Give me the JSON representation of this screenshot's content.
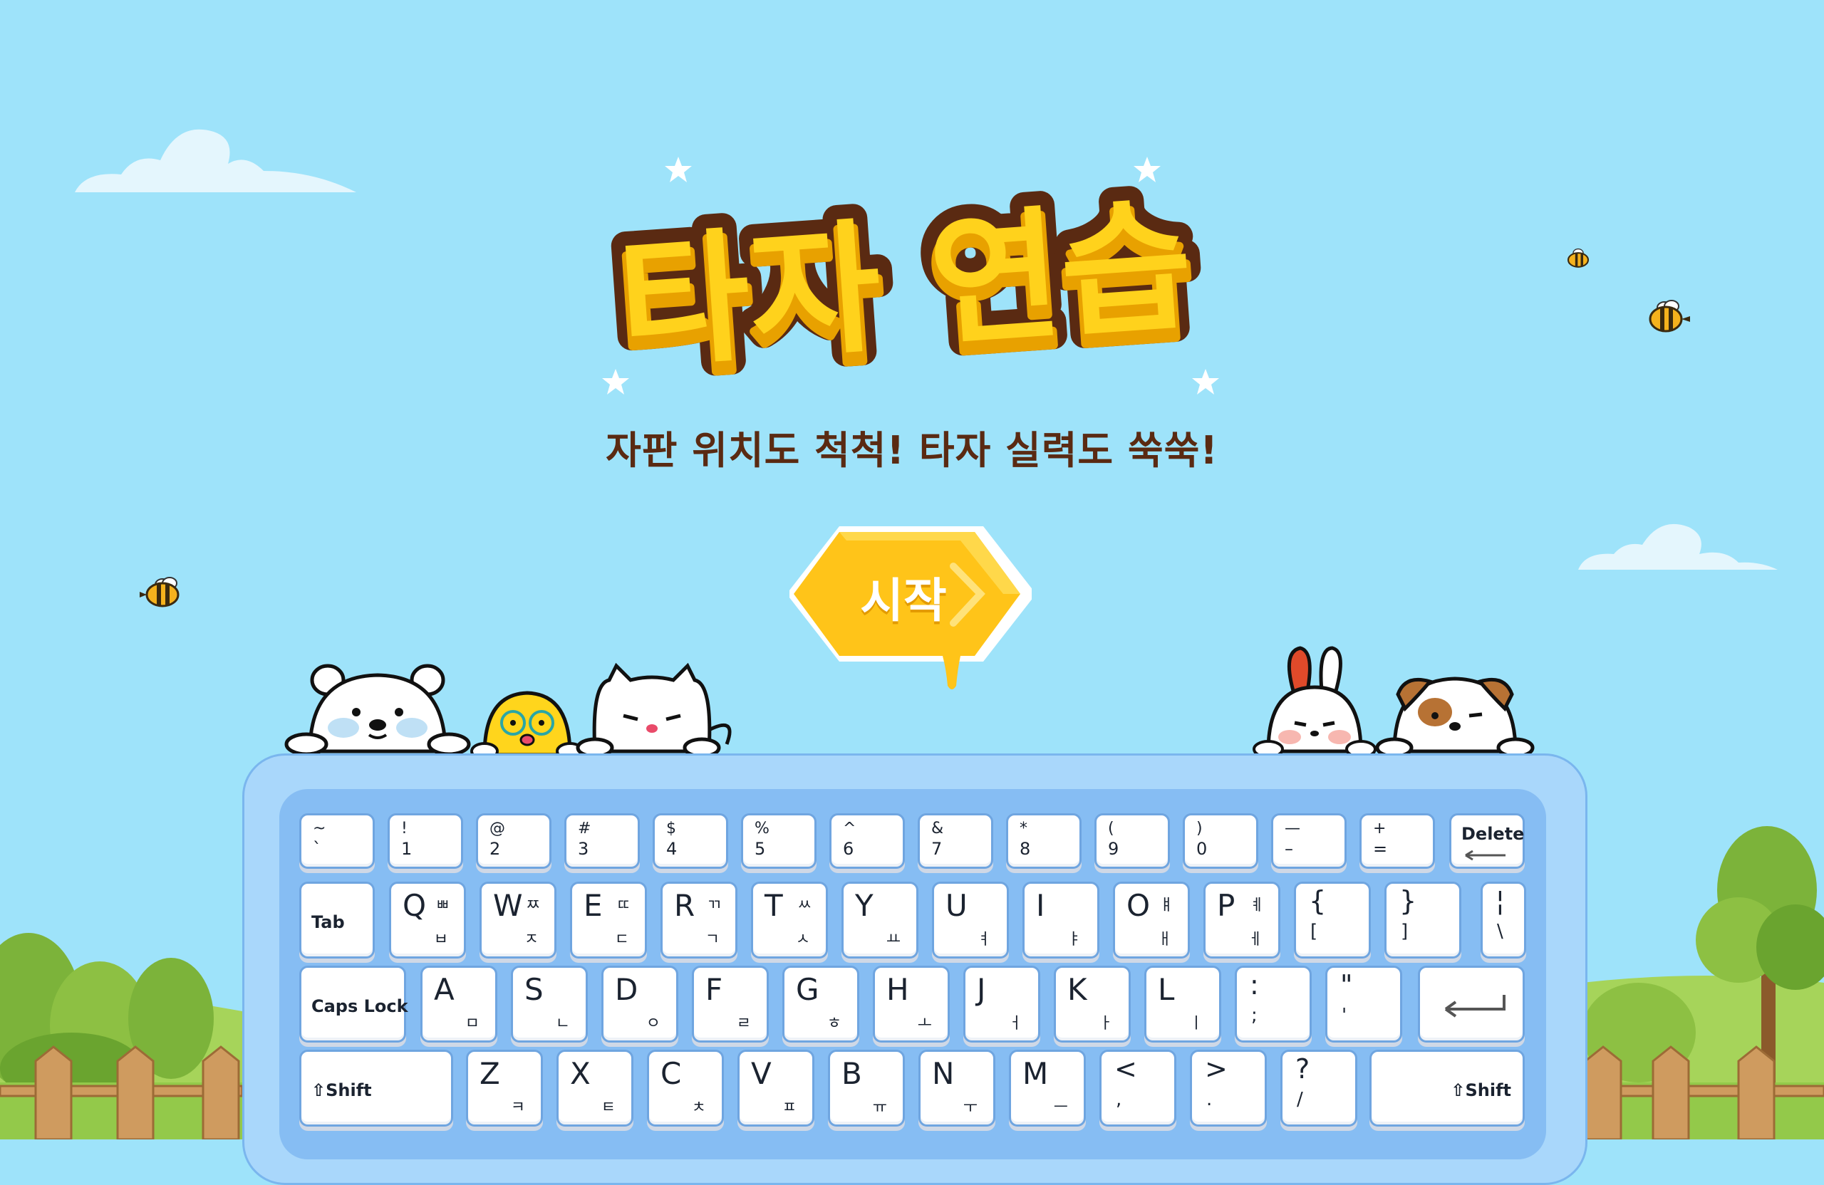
{
  "title": {
    "main": "타자 연습",
    "subtitle": "자판 위치도 척척! 타자 실력도 쑥쑥!"
  },
  "start_button": {
    "label": "시작"
  },
  "colors": {
    "sky": "#9ee3fa",
    "title_fill": "#ffd21c",
    "title_outline": "#5a2a12",
    "button": "#ffc419",
    "grass": "#93c94a",
    "keyboard": "#86bdf3"
  },
  "keyboard": {
    "row1": [
      {
        "top": "~",
        "bot": "`"
      },
      {
        "top": "!",
        "bot": "1"
      },
      {
        "top": "@",
        "bot": "2"
      },
      {
        "top": "#",
        "bot": "3"
      },
      {
        "top": "$",
        "bot": "4"
      },
      {
        "top": "%",
        "bot": "5"
      },
      {
        "top": "^",
        "bot": "6"
      },
      {
        "top": "&",
        "bot": "7"
      },
      {
        "top": "*",
        "bot": "8"
      },
      {
        "top": "(",
        "bot": "9"
      },
      {
        "top": ")",
        "bot": "0"
      },
      {
        "top": "—",
        "bot": "–"
      },
      {
        "top": "+",
        "bot": "="
      }
    ],
    "delete_label": "Delete",
    "tab_label": "Tab",
    "row2": [
      {
        "main": "Q",
        "kr1": "ㅃ",
        "kr2": "ㅂ"
      },
      {
        "main": "W",
        "kr1": "ㅉ",
        "kr2": "ㅈ"
      },
      {
        "main": "E",
        "kr1": "ㄸ",
        "kr2": "ㄷ"
      },
      {
        "main": "R",
        "kr1": "ㄲ",
        "kr2": "ㄱ"
      },
      {
        "main": "T",
        "kr1": "ㅆ",
        "kr2": "ㅅ"
      },
      {
        "main": "Y",
        "kr1": "",
        "kr2": "ㅛ"
      },
      {
        "main": "U",
        "kr1": "",
        "kr2": "ㅕ"
      },
      {
        "main": "I",
        "kr1": "",
        "kr2": "ㅑ"
      },
      {
        "main": "O",
        "kr1": "ㅒ",
        "kr2": "ㅐ"
      },
      {
        "main": "P",
        "kr1": "ㅖ",
        "kr2": "ㅔ"
      }
    ],
    "row2_sym": [
      {
        "top": "{",
        "bot": "["
      },
      {
        "top": "}",
        "bot": "]"
      },
      {
        "top": "¦",
        "bot": "\\"
      }
    ],
    "caps_label": "Caps Lock",
    "row3": [
      {
        "main": "A",
        "kr2": "ㅁ"
      },
      {
        "main": "S",
        "kr2": "ㄴ"
      },
      {
        "main": "D",
        "kr2": "ㅇ"
      },
      {
        "main": "F",
        "kr2": "ㄹ"
      },
      {
        "main": "G",
        "kr2": "ㅎ"
      },
      {
        "main": "H",
        "kr2": "ㅗ"
      },
      {
        "main": "J",
        "kr2": "ㅓ"
      },
      {
        "main": "K",
        "kr2": "ㅏ"
      },
      {
        "main": "L",
        "kr2": "ㅣ"
      }
    ],
    "row3_sym": [
      {
        "top": ":",
        "bot": ";"
      },
      {
        "top": "\"",
        "bot": "'"
      }
    ],
    "shift_label": "Shift",
    "row4": [
      {
        "main": "Z",
        "kr2": "ㅋ"
      },
      {
        "main": "X",
        "kr2": "ㅌ"
      },
      {
        "main": "C",
        "kr2": "ㅊ"
      },
      {
        "main": "V",
        "kr2": "ㅍ"
      },
      {
        "main": "B",
        "kr2": "ㅠ"
      },
      {
        "main": "N",
        "kr2": "ㅜ"
      },
      {
        "main": "M",
        "kr2": "ㅡ"
      }
    ],
    "row4_sym": [
      {
        "top": "<",
        "bot": ","
      },
      {
        "top": ">",
        "bot": "."
      },
      {
        "top": "?",
        "bot": "/"
      }
    ]
  },
  "characters": [
    "polar-bear",
    "yellow-chick",
    "white-cat",
    "white-rabbit",
    "spotted-dog"
  ]
}
